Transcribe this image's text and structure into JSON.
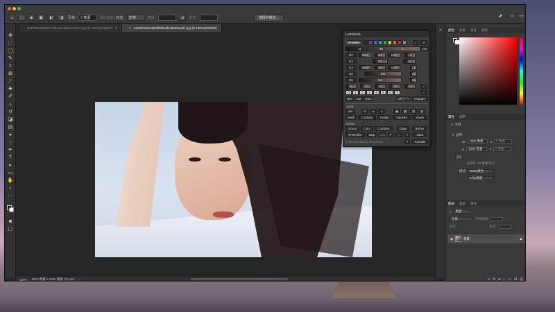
{
  "options_bar": {
    "feather_label": "羽化:",
    "feather_value": "0 像素",
    "antialias_label": "消除锯齿",
    "style_label": "样式:",
    "style_value": "正常",
    "width_label": "宽度:",
    "height_label": "高度:",
    "select_subject_label": "选择并遮住..."
  },
  "tabs": [
    {
      "label": "9e370b9a5b88ca7d5ea431faaacaa647.jpg @ 100%(RGB/8#)"
    },
    {
      "label": "33a307d2944bbdf8fdedbc9b326ad67.jpg @ 100%(RGB/8#)"
    }
  ],
  "status": {
    "zoom": "100%",
    "doc_info": "1920 像素 x 1080 像素 (72 ppi)"
  },
  "lumenzia": {
    "title": "Lumenzia",
    "preview": "Preview",
    "x_btn": "X",
    "not_btn": "Not",
    "d_btn": "D",
    "m_btn": "M",
    "l_btn": "L",
    "d2": "D2",
    "dm1": "DM1",
    "m2": "M2",
    "lm1": "LM1",
    "l2": "L2",
    "d3": "D3",
    "m3": "M3",
    "l3": "L3",
    "d4": "D4",
    "dm2": "DM2",
    "m4": "M4",
    "lm2": "LM2",
    "l4": "L4",
    "d5": "D5",
    "m5": "M5",
    "l5": "L5",
    "d6": "D6",
    "m6": "M6",
    "l6": "L6",
    "a_btn": "(a)",
    "b_btn": "(b)",
    "c_btn": "(c)",
    "d_paren": "(d)",
    "e_btn": "(e)",
    "zero": "0",
    "one": "1",
    "two": "2",
    "three": "3",
    "four": "4",
    "five": "5",
    "six": "6",
    "seven": "7",
    "nite": "Nite",
    "sat": "Sat",
    "gam": "Gam",
    "diff": "Diff (+/-)",
    "range": "<Range>",
    "apply_label": "Apply",
    "sel": "Sel",
    "mask": "Mask",
    "contrast": "Contrast",
    "dodge": "Dodge",
    "vignette": "Vignette",
    "sharp": "Sharp",
    "refine_label": "Refine",
    "group": "Group",
    "color": "Color",
    "combine": "Combine",
    "edge": "Edge",
    "before": "Before",
    "prerefine": "PreRefine",
    "map": "Map",
    "split": "Split",
    "mask_dust": "√dust",
    "footer": "Lumenzia v9.2.0 Greg Benz",
    "q": "?",
    "tutorials": "Tutorials"
  },
  "right_panel": {
    "color_tabs": [
      "颜色",
      "色板",
      "渐变",
      "图案"
    ],
    "props_tabs": [
      "属性",
      "调整"
    ],
    "doc_label": "文档",
    "canvas_label": "画布",
    "w_label": "W",
    "w_value": "1920 像素",
    "x_label": "X",
    "x_value": "0 像素",
    "h_label": "H",
    "h_value": "1080 像素",
    "y_label": "Y",
    "y_value": "0 像素",
    "resolution": "分辨率: 72 像素/英寸",
    "mode_label": "模式",
    "mode_value": "RGB 颜色",
    "bits_value": "8 位/通道",
    "layers_tabs": [
      "图层",
      "通道",
      "路径"
    ],
    "layer_search": "类型",
    "blend_mode": "正常",
    "opacity": "不透明度:",
    "fill_label": "填充:",
    "lock_label": "锁定:",
    "layer_name": "背景"
  },
  "colors": {
    "accent": "#31a8ff",
    "window_bg": "#262626",
    "panel_bg": "#383838"
  }
}
